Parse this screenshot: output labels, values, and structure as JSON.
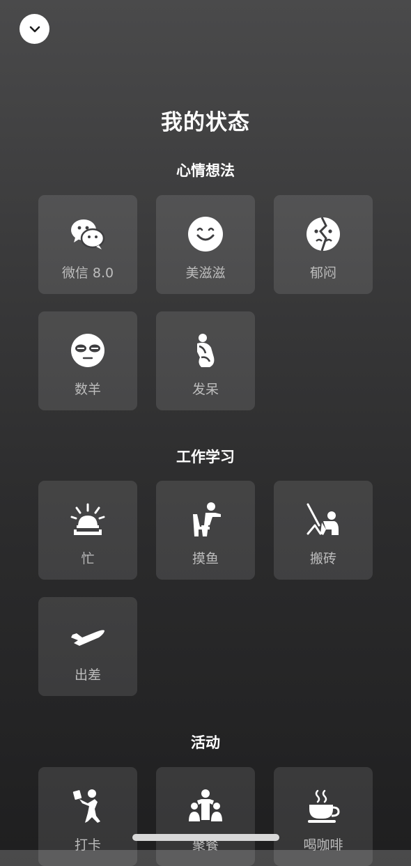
{
  "page_title": "我的状态",
  "collapse_icon": "chevron-down-icon",
  "sections": [
    {
      "title": "心情想法",
      "items": [
        {
          "label": "微信 8.0",
          "icon": "wechat-icon"
        },
        {
          "label": "美滋滋",
          "icon": "smiley-icon"
        },
        {
          "label": "郁闷",
          "icon": "cracked-face-icon"
        },
        {
          "label": "数羊",
          "icon": "sleepy-face-icon"
        },
        {
          "label": "发呆",
          "icon": "thinker-icon"
        }
      ]
    },
    {
      "title": "工作学习",
      "items": [
        {
          "label": "忙",
          "icon": "siren-icon"
        },
        {
          "label": "摸鱼",
          "icon": "slacking-person-icon"
        },
        {
          "label": "搬砖",
          "icon": "laborer-icon"
        },
        {
          "label": "出差",
          "icon": "airplane-icon"
        }
      ]
    },
    {
      "title": "活动",
      "items": [
        {
          "label": "打卡",
          "icon": "walking-person-icon"
        },
        {
          "label": "聚餐",
          "icon": "group-people-icon"
        },
        {
          "label": "喝咖啡",
          "icon": "coffee-cup-icon"
        }
      ]
    }
  ]
}
